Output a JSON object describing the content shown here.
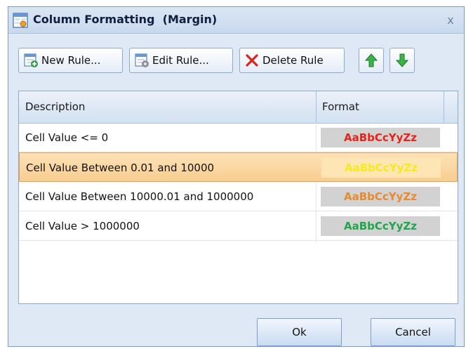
{
  "dialog": {
    "title": "Column Formatting  (Margin)",
    "close_glyph": "x"
  },
  "toolbar": {
    "new_rule": {
      "label": "New Rule...",
      "icon": "new-rule-icon"
    },
    "edit_rule": {
      "label": "Edit Rule...",
      "icon": "edit-rule-icon"
    },
    "delete_rule": {
      "label": "Delete Rule",
      "icon": "delete-x-icon"
    },
    "move_up": {
      "icon": "arrow-up-icon"
    },
    "move_down": {
      "icon": "arrow-down-icon"
    }
  },
  "grid": {
    "columns": [
      "Description",
      "Format"
    ],
    "rows": [
      {
        "description": "Cell Value <= 0",
        "format_sample": "AaBbCcYyZz",
        "color": "#e8221a",
        "selected": false
      },
      {
        "description": "Cell Value Between 0.01 and 10000",
        "format_sample": "AaBbCcYyZz",
        "color": "#f4ea1c",
        "selected": true
      },
      {
        "description": "Cell Value Between 10000.01 and 1000000",
        "format_sample": "AaBbCcYyZz",
        "color": "#e88a2e",
        "selected": false
      },
      {
        "description": "Cell Value > 1000000",
        "format_sample": "AaBbCcYyZz",
        "color": "#1fa64a",
        "selected": false
      }
    ]
  },
  "buttons": {
    "ok": "Ok",
    "cancel": "Cancel"
  },
  "colors": {
    "title_bar": "#cbd9ee",
    "selection": "#f8cd90",
    "format_bg": "#d2d2d2"
  }
}
